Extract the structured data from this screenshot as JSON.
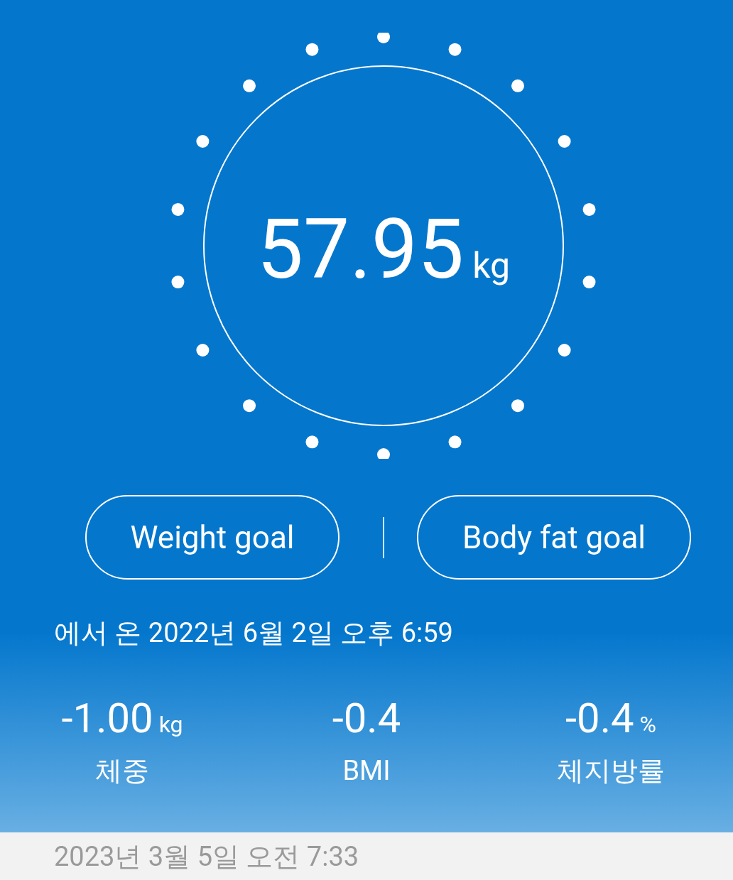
{
  "weight": {
    "value": "57.95",
    "unit": "kg"
  },
  "goal_buttons": [
    "Weight goal",
    "Body fat goal"
  ],
  "measured_at": "에서 온 2022년 6월 2일 오후 6:59",
  "stats": [
    {
      "value": "-1.00",
      "unit": "kg",
      "label": "체중"
    },
    {
      "value": "-0.4",
      "label": "BMI"
    },
    {
      "value": "-0.4",
      "unit": "%",
      "label": "체지방률"
    }
  ],
  "section_header": "2023년 3월 5일 오전 7:33"
}
